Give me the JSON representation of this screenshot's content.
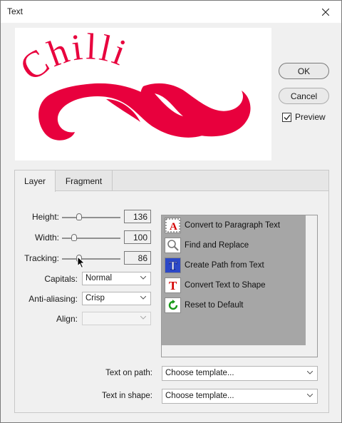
{
  "window": {
    "title": "Text"
  },
  "buttons": {
    "ok": "OK",
    "cancel": "Cancel"
  },
  "preview_option": {
    "label": "Preview",
    "checked": true
  },
  "preview_image": {
    "text": "Chilli",
    "color": "#e8003d"
  },
  "tabs": [
    {
      "label": "Layer"
    },
    {
      "label": "Fragment"
    }
  ],
  "settings": {
    "height": {
      "label": "Height:",
      "value": "136"
    },
    "width": {
      "label": "Width:",
      "value": "100"
    },
    "tracking": {
      "label": "Tracking:",
      "value": "86"
    },
    "capitals": {
      "label": "Capitals:",
      "value": "Normal"
    },
    "anti_aliasing": {
      "label": "Anti-aliasing:",
      "value": "Crisp"
    },
    "align": {
      "label": "Align:",
      "value": ""
    }
  },
  "commands": [
    {
      "label": "Convert to Paragraph Text",
      "icon": "paragraph-text-icon"
    },
    {
      "label": "Find and Replace",
      "icon": "magnifier-icon"
    },
    {
      "label": "Create Path from Text",
      "icon": "text-path-icon"
    },
    {
      "label": "Convert Text to Shape",
      "icon": "text-shape-icon"
    },
    {
      "label": "Reset to Default",
      "icon": "reset-icon"
    }
  ],
  "text_on_path": {
    "label": "Text on path:",
    "value": "Choose template..."
  },
  "text_in_shape": {
    "label": "Text in shape:",
    "value": "Choose template..."
  }
}
